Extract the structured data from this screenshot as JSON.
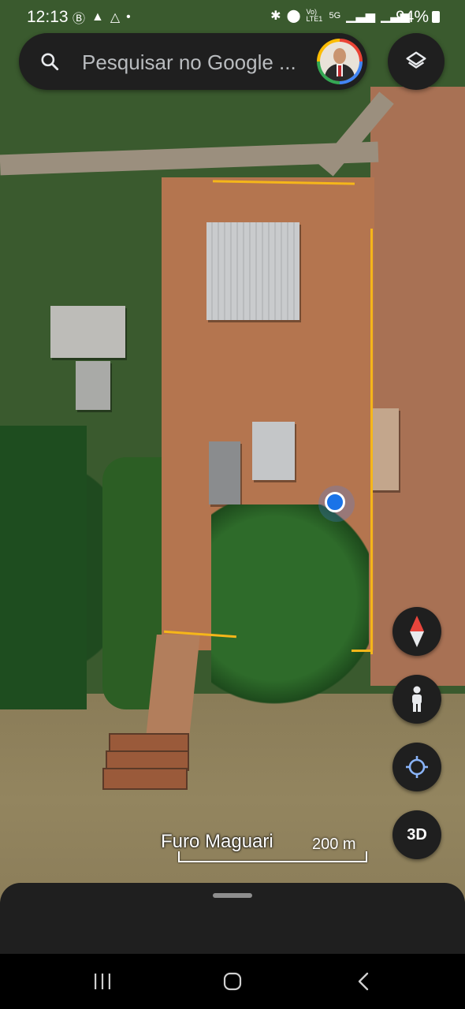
{
  "status_bar": {
    "time": "12:13",
    "battery": "94%",
    "network": "5G",
    "volte": "Vo) LTE1"
  },
  "search": {
    "placeholder": "Pesquisar no Google ..."
  },
  "map": {
    "place_label": "Furo Maguari",
    "scale_label": "200 m",
    "type": "satellite",
    "boundary_color": "#f5b61a",
    "location_color": "#1a73e8"
  },
  "controls": {
    "threed_label": "3D",
    "layers_icon": "layers-icon",
    "compass_icon": "compass-icon",
    "pegman_icon": "street-view-icon",
    "my_location_icon": "my-location-icon"
  },
  "colors": {
    "surface": "#1f1f1f",
    "compass_red": "#e8453c"
  }
}
